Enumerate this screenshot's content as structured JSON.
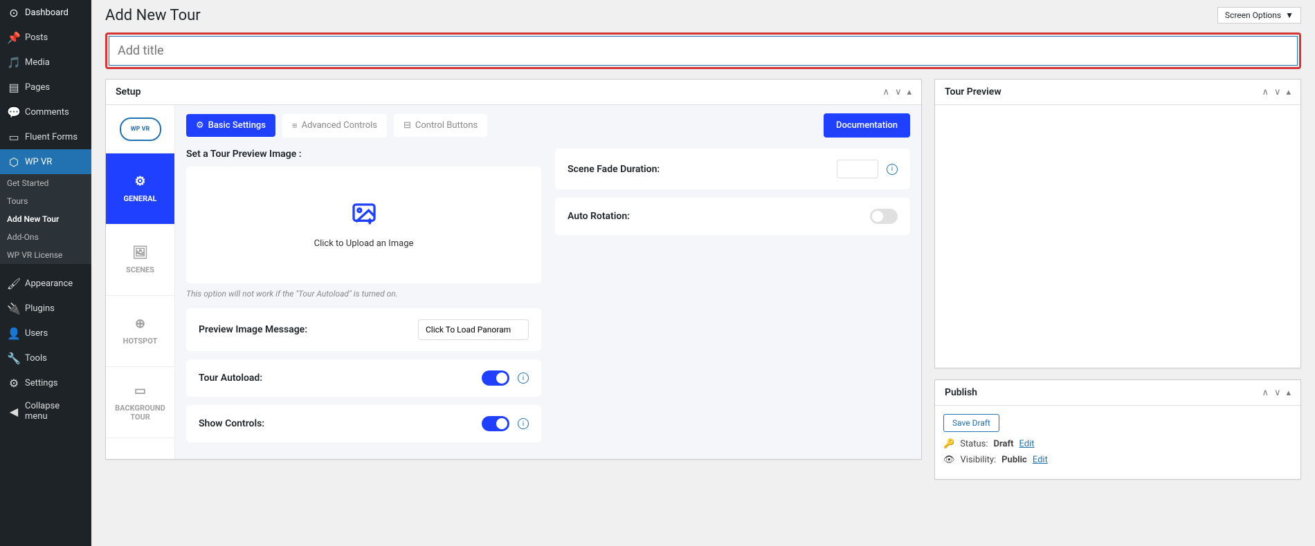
{
  "screen_options": "Screen Options",
  "page_title": "Add New Tour",
  "title_placeholder": "Add title",
  "sidebar": {
    "items": [
      {
        "label": "Dashboard",
        "icon": "dashboard"
      },
      {
        "label": "Posts",
        "icon": "pin"
      },
      {
        "label": "Media",
        "icon": "media"
      },
      {
        "label": "Pages",
        "icon": "pages"
      },
      {
        "label": "Comments",
        "icon": "comment"
      },
      {
        "label": "Fluent Forms",
        "icon": "form"
      },
      {
        "label": "WP VR",
        "icon": "wpvr"
      },
      {
        "label": "Appearance",
        "icon": "appearance"
      },
      {
        "label": "Plugins",
        "icon": "plugins"
      },
      {
        "label": "Users",
        "icon": "users"
      },
      {
        "label": "Tools",
        "icon": "tools"
      },
      {
        "label": "Settings",
        "icon": "settings"
      },
      {
        "label": "Collapse menu",
        "icon": "collapse"
      }
    ],
    "sub": [
      {
        "label": "Get Started"
      },
      {
        "label": "Tours"
      },
      {
        "label": "Add New Tour"
      },
      {
        "label": "Add-Ons"
      },
      {
        "label": "WP VR License"
      }
    ]
  },
  "panels": {
    "setup_title": "Setup",
    "preview_title": "Tour Preview",
    "publish_title": "Publish"
  },
  "vtabs": {
    "logo": "WP VR",
    "general": "GENERAL",
    "scenes": "SCENES",
    "hotspot": "HOTSPOT",
    "background": "BACKGROUND TOUR"
  },
  "top_tabs": {
    "basic": "Basic Settings",
    "advanced": "Advanced Controls",
    "control": "Control Buttons",
    "documentation": "Documentation"
  },
  "fields": {
    "preview_label": "Set a Tour Preview Image :",
    "upload_text": "Click to Upload an Image",
    "preview_hint": "This option will not work if the \"Tour Autoload\" is turned on.",
    "preview_msg_label": "Preview Image Message:",
    "preview_msg_value": "Click To Load Panoram",
    "autoload_label": "Tour Autoload:",
    "controls_label": "Show Controls:",
    "fade_label": "Scene Fade Duration:",
    "rotation_label": "Auto Rotation:"
  },
  "publish": {
    "save_draft": "Save Draft",
    "status_label": "Status: ",
    "status_value": "Draft",
    "status_edit": "Edit",
    "vis_label": "Visibility: ",
    "vis_value": "Public",
    "vis_edit": "Edit"
  }
}
